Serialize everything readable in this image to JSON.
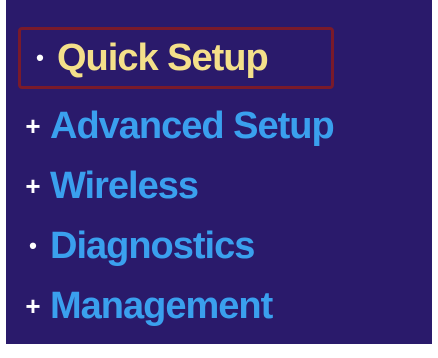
{
  "colors": {
    "panel_background": "#2a1a6b",
    "link_color": "#3aa0ee",
    "active_link_color": "#f4e08a",
    "active_border": "#7a1a2a",
    "bullet_color": "#ffffff"
  },
  "menu": {
    "items": [
      {
        "label": "Quick Setup",
        "bullet": "•",
        "bullet_icon": "dot-bullet-icon",
        "active": true
      },
      {
        "label": "Advanced Setup",
        "bullet": "+",
        "bullet_icon": "plus-expand-icon",
        "active": false
      },
      {
        "label": "Wireless",
        "bullet": "+",
        "bullet_icon": "plus-expand-icon",
        "active": false
      },
      {
        "label": "Diagnostics",
        "bullet": "•",
        "bullet_icon": "dot-bullet-icon",
        "active": false
      },
      {
        "label": "Management",
        "bullet": "+",
        "bullet_icon": "plus-expand-icon",
        "active": false
      }
    ]
  }
}
